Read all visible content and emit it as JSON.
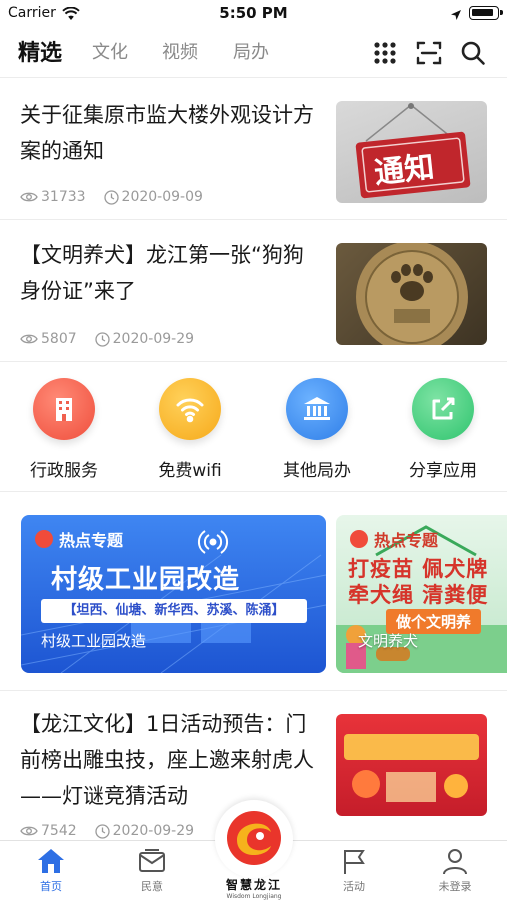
{
  "status_bar": {
    "carrier": "Carrier",
    "time": "5:50 PM"
  },
  "nav": {
    "tabs": [
      "精选",
      "文化",
      "视频",
      "局办"
    ],
    "active_tab": "精选"
  },
  "articles": [
    {
      "title": "关于征集原市监大楼外观设计方案的通知",
      "views": "31733",
      "date": "2020-09-09",
      "thumb_text": "通知"
    },
    {
      "title": "【文明养犬】龙江第一张“狗狗身份证”来了",
      "views": "5807",
      "date": "2020-09-29",
      "thumb_text": ""
    },
    {
      "title": "【龙江文化】1日活动预告：门前榜出雕虫技，座上邀来射虎人——灯谜竞猜活动",
      "views": "7542",
      "date": "2020-09-29",
      "thumb_text": ""
    }
  ],
  "services": [
    {
      "label": "行政服务",
      "icon": "building-icon",
      "color": "#f0604e"
    },
    {
      "label": "免费wifi",
      "icon": "wifi-icon",
      "color": "#f7b125"
    },
    {
      "label": "其他局办",
      "icon": "bank-icon",
      "color": "#3d8ef0"
    },
    {
      "label": "分享应用",
      "icon": "share-icon",
      "color": "#3ccf7a"
    }
  ],
  "banners": [
    {
      "tag": "热点专题",
      "headline": "村级工业园改造",
      "districts": "【坦西、仙塘、新华西、苏溪、陈涌】",
      "caption": "村级工业园改造"
    },
    {
      "tag": "热点专题",
      "headline_line1": "打疫苗 佩犬牌",
      "headline_line2": "牵犬绳 清粪便",
      "slogan": "做个文明养",
      "caption": "文明养犬"
    }
  ],
  "tabbar": {
    "items": [
      "首页",
      "民意",
      "活动",
      "未登录"
    ],
    "active": "首页",
    "center_logo_cn": "智慧龙江",
    "center_logo_en": "Wisdom Longjiang"
  },
  "colors": {
    "accent": "#2e6fe4",
    "divider": "#ececec"
  }
}
